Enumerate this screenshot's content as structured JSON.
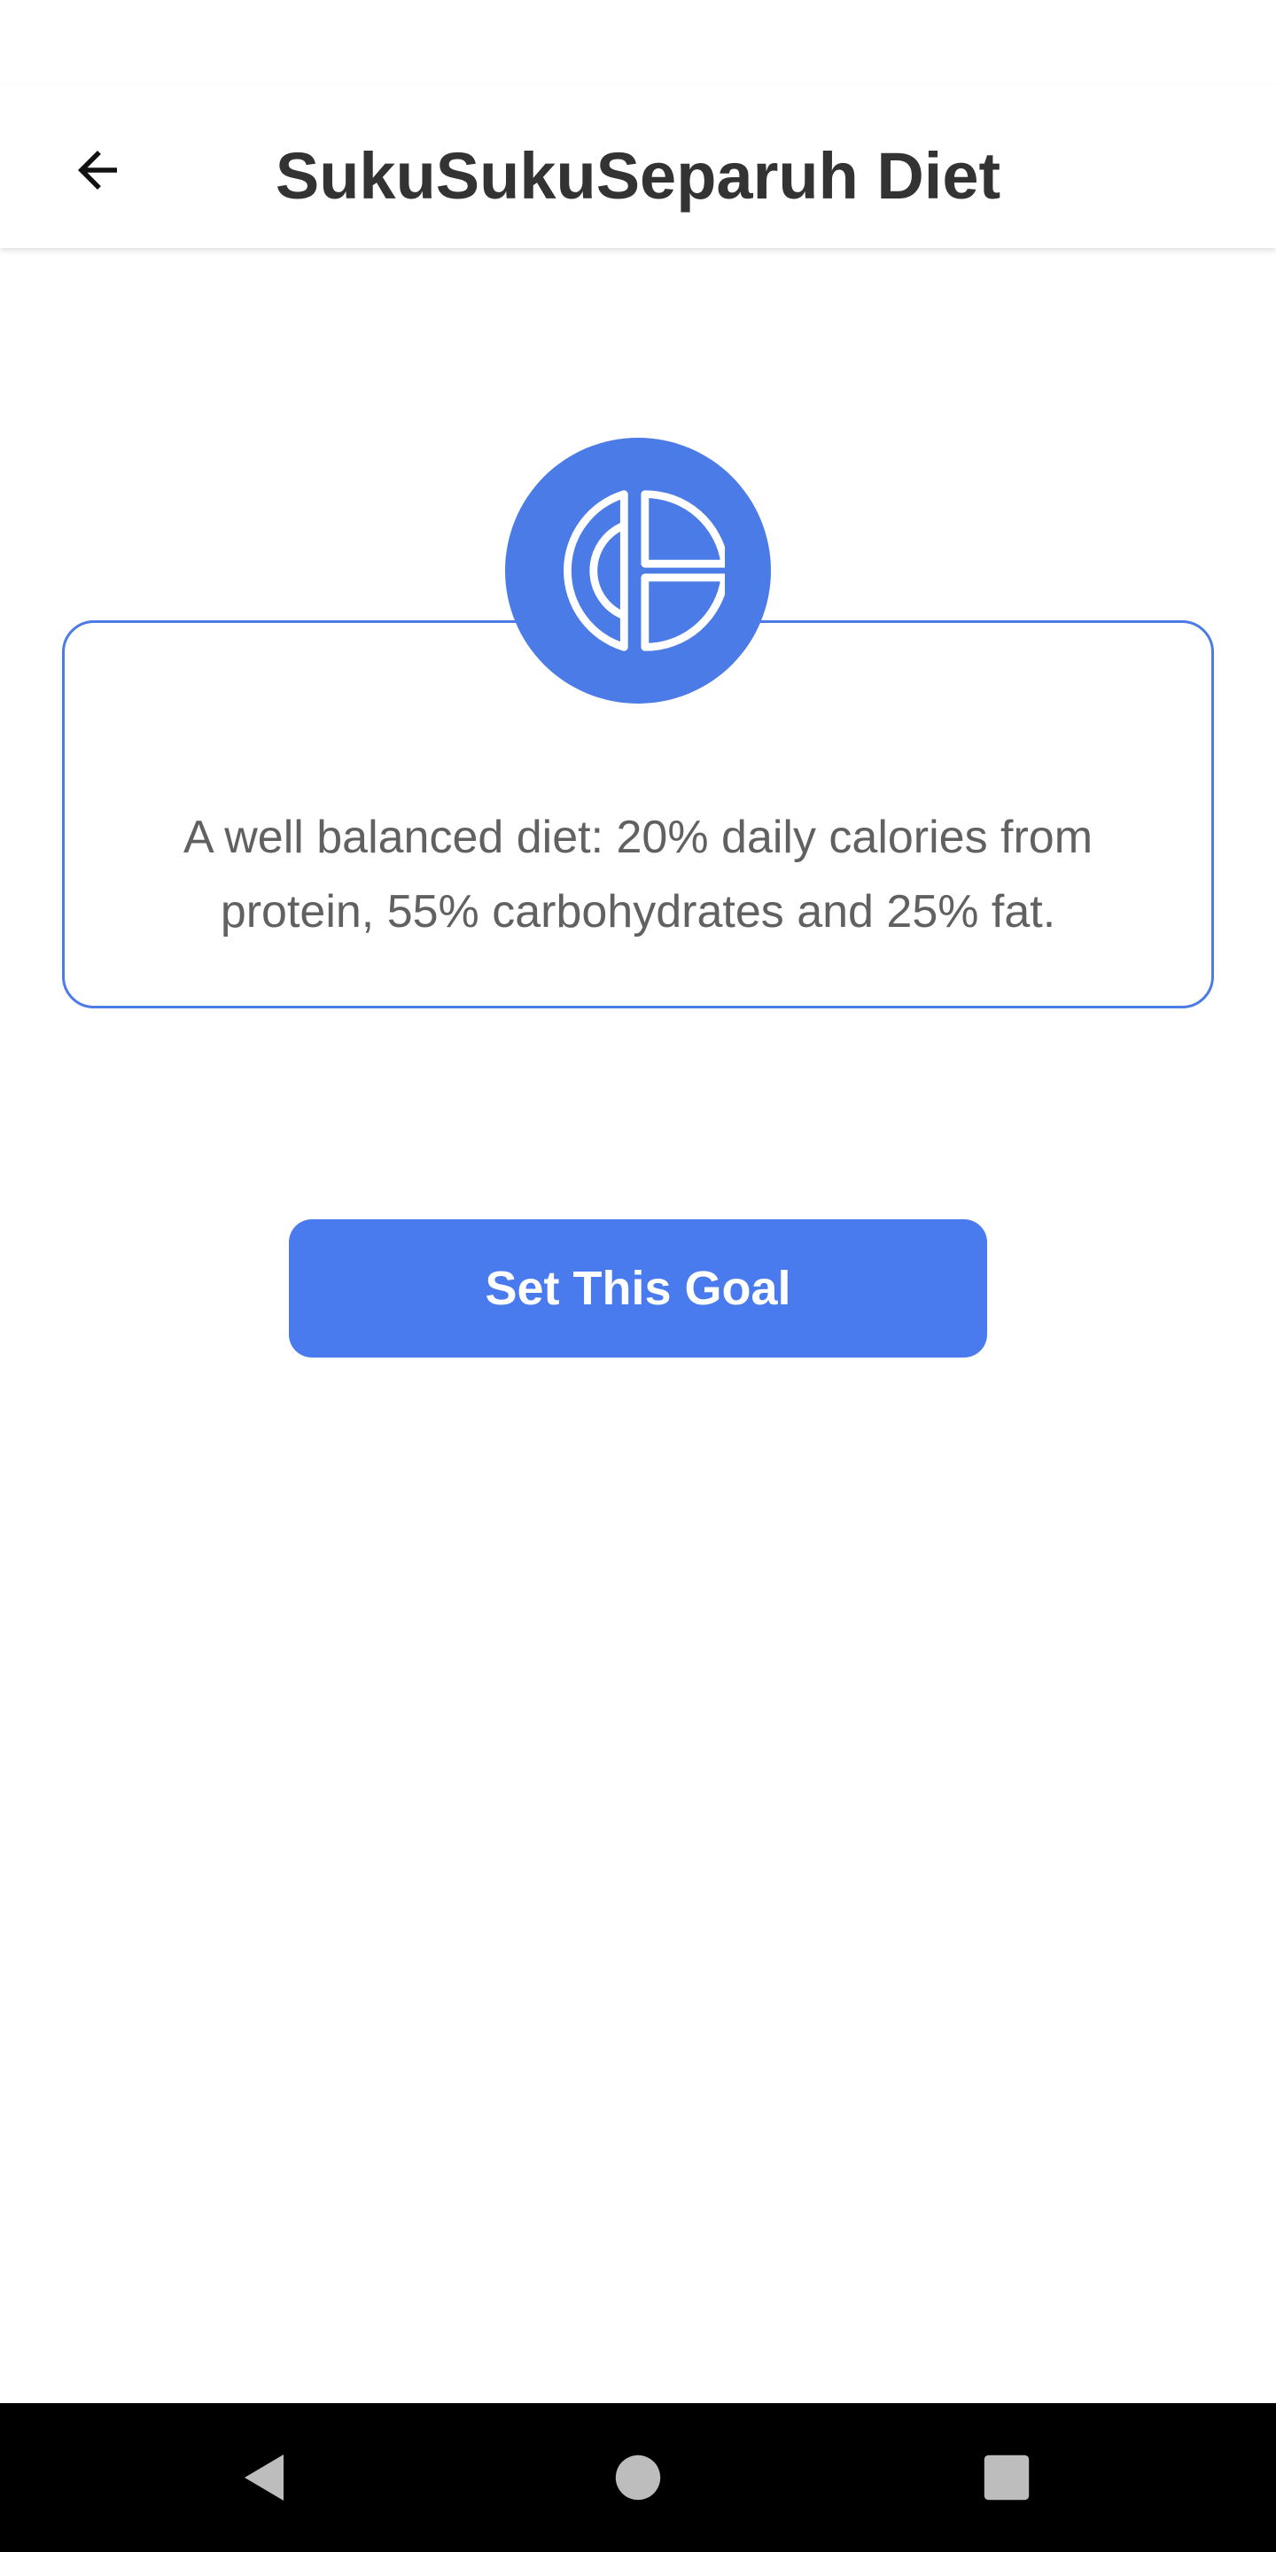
{
  "header": {
    "title": "SukuSukuSeparuh Diet",
    "back_icon": "arrow-left-icon"
  },
  "card": {
    "icon": "macro-pie-chart-icon",
    "description": "A well balanced diet: 20% daily calories from protein, 55% carbohydrates and 25% fat."
  },
  "action": {
    "set_goal_label": "Set This Goal"
  },
  "system_nav": {
    "back_icon": "triangle-back-icon",
    "home_icon": "circle-home-icon",
    "recents_icon": "square-recents-icon"
  },
  "colors": {
    "accent": "#4a7be6",
    "button": "#4a7bee",
    "title_text": "#333333",
    "body_text": "#616161",
    "nav_bar": "#000000",
    "nav_icons": "#bdbdbd"
  }
}
